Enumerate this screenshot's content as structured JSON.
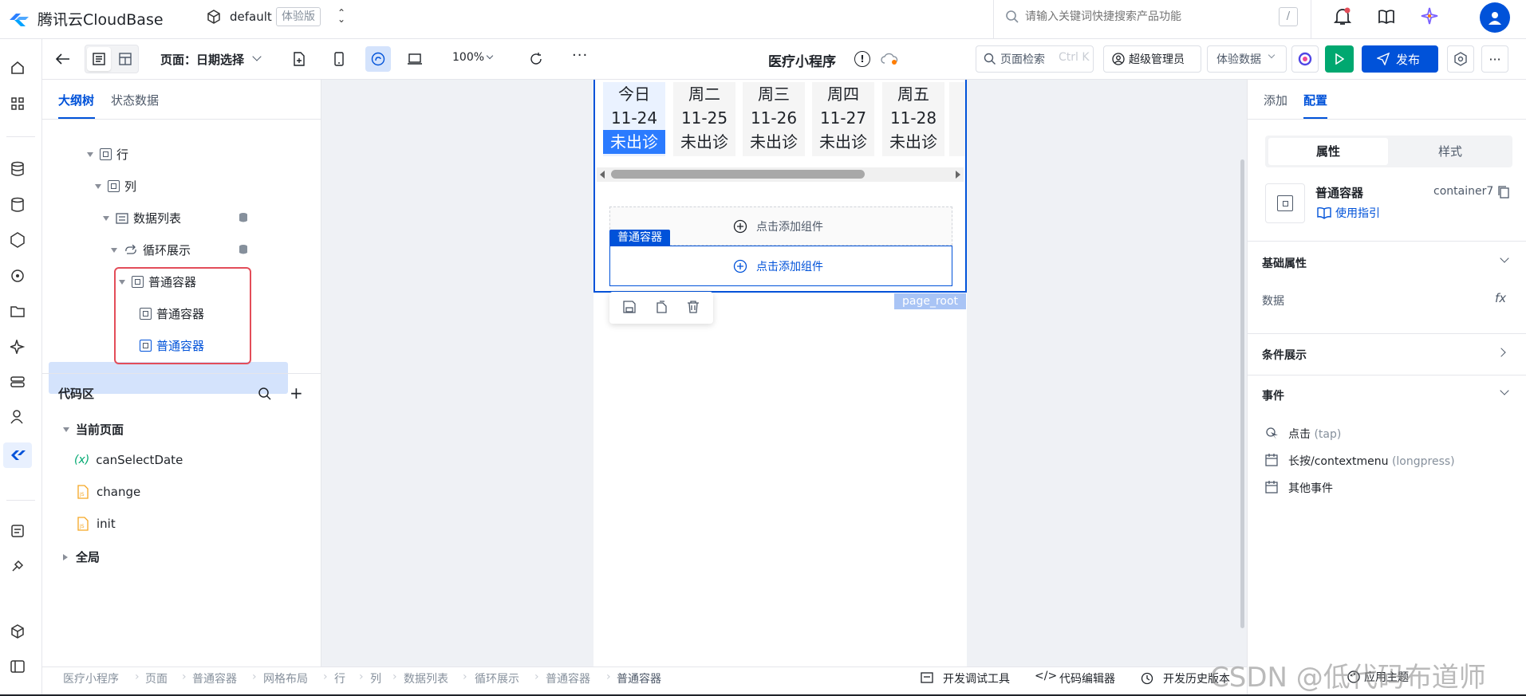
{
  "topbar": {
    "brand": "腾讯云CloudBase",
    "env_name": "default",
    "env_badge": "体验版",
    "search_placeholder": "请输入关键词快捷搜索产品功能",
    "search_shortcut": "/"
  },
  "toolbar": {
    "page_label": "页面：日期选择",
    "zoom": "100%",
    "app_title": "医疗小程序",
    "page_search": "页面检索",
    "page_search_shortcut": "Ctrl K",
    "admin_label": "超级管理员",
    "data_label": "体验数据",
    "publish_label": "发布"
  },
  "outline": {
    "tabs": [
      "大纲树",
      "状态数据"
    ],
    "nodes": [
      "行",
      "列",
      "数据列表",
      "循环展示",
      "普通容器",
      "普通容器",
      "普通容器"
    ]
  },
  "code": {
    "title": "代码区",
    "current_page": "当前页面",
    "items": [
      {
        "label": "canSelectDate",
        "type": "var"
      },
      {
        "label": "change",
        "type": "js"
      },
      {
        "label": "init",
        "type": "js"
      }
    ],
    "global": "全局"
  },
  "canvas": {
    "days": [
      {
        "weekday": "今日",
        "date": "11-24",
        "status": "未出诊",
        "selected": true
      },
      {
        "weekday": "周二",
        "date": "11-25",
        "status": "未出诊",
        "selected": false
      },
      {
        "weekday": "周三",
        "date": "11-26",
        "status": "未出诊",
        "selected": false
      },
      {
        "weekday": "周四",
        "date": "11-27",
        "status": "未出诊",
        "selected": false
      },
      {
        "weekday": "周五",
        "date": "11-28",
        "status": "未出诊",
        "selected": false
      }
    ],
    "add_component": "点击添加组件",
    "selected_tag": "普通容器",
    "page_root": "page_root"
  },
  "right": {
    "tabs": [
      "添加",
      "配置"
    ],
    "seg": [
      "属性",
      "样式"
    ],
    "component_name": "普通容器",
    "component_id": "container7",
    "guide": "使用指引",
    "sections": {
      "basic": "基础属性",
      "data": "数据",
      "fx": "fx",
      "condition": "条件展示",
      "events": "事件"
    },
    "events": [
      {
        "label": "点击",
        "tag": "(tap)"
      },
      {
        "label": "长按/contextmenu",
        "tag": "(longpress)"
      },
      {
        "label": "其他事件",
        "tag": ""
      }
    ],
    "theme": "应用主题"
  },
  "statusbar": {
    "breadcrumb": [
      "医疗小程序",
      "页面",
      "普通容器",
      "网格布局",
      "行",
      "列",
      "数据列表",
      "循环展示",
      "普通容器",
      "普通容器"
    ],
    "devtools": "开发调试工具",
    "code_editor": "代码编辑器",
    "history": "开发历史版本"
  },
  "watermark": "CSDN @低代码布道师",
  "colors": {
    "primary": "#0052d9",
    "accent_red": "#e34d59",
    "selected_bg": "#d4e3fc",
    "canvas_bg": "#eff1f5"
  }
}
